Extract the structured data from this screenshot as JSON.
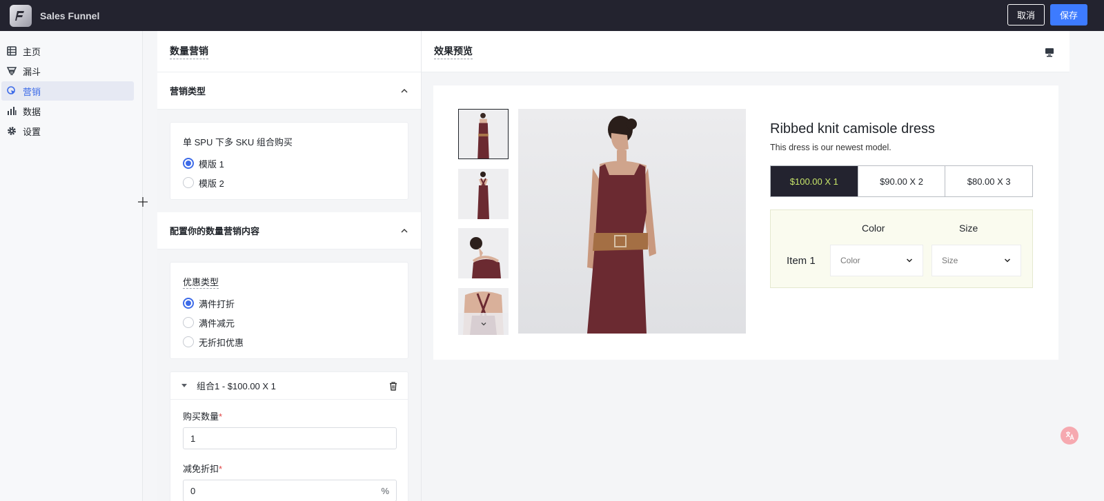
{
  "app": {
    "title": "Sales Funnel",
    "cancel_label": "取消",
    "save_label": "保存"
  },
  "sidebar": {
    "items": [
      {
        "label": "主页",
        "icon": "list-icon"
      },
      {
        "label": "漏斗",
        "icon": "funnel-icon"
      },
      {
        "label": "营销",
        "icon": "marketing-icon",
        "active": true
      },
      {
        "label": "数据",
        "icon": "bar-chart-icon"
      },
      {
        "label": "设置",
        "icon": "gear-icon"
      }
    ]
  },
  "editor": {
    "title": "数量营销",
    "marketing_type": {
      "title": "营销类型",
      "card_title": "单 SPU 下多 SKU 组合购买",
      "options": [
        "模版 1",
        "模版 2"
      ],
      "selected": "模版 1"
    },
    "config": {
      "title": "配置你的数量营销内容",
      "discount_type_label": "优惠类型",
      "options": [
        "满件打折",
        "满件减元",
        "无折扣优惠"
      ],
      "selected": "满件打折"
    },
    "combo": {
      "title": "组合1 - $100.00 X 1",
      "qty_label": "购买数量",
      "qty_value": "1",
      "discount_label": "减免折扣",
      "discount_value": "0",
      "discount_suffix": "%",
      "required_mark": "*"
    }
  },
  "preview": {
    "title": "效果预览",
    "product": {
      "title": "Ribbed knit camisole dress",
      "description": "This dress is our newest model.",
      "quantity_options": [
        "$100.00 X 1",
        "$90.00 X 2",
        "$80.00 X 3"
      ],
      "selected_option": "$100.00 X 1",
      "variant": {
        "color_header": "Color",
        "size_header": "Size",
        "item_label": "Item 1",
        "color_placeholder": "Color",
        "size_placeholder": "Size"
      }
    }
  },
  "colors": {
    "topbar": "#23232f",
    "accent": "#3d7bff",
    "active_nav": "#3d6be8",
    "selected_option_text": "#c8e66a",
    "dress": "#6b2a31"
  }
}
